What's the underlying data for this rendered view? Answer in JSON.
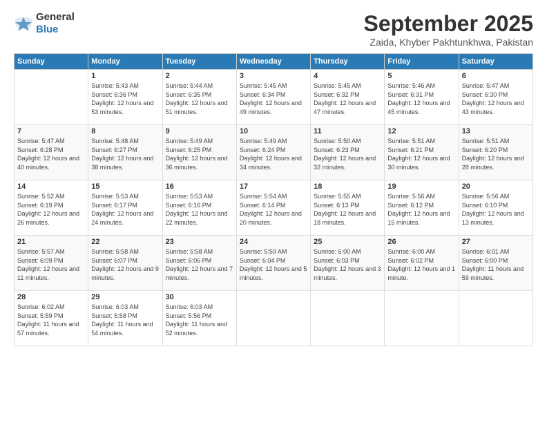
{
  "logo": {
    "general": "General",
    "blue": "Blue"
  },
  "title": "September 2025",
  "location": "Zaida, Khyber Pakhtunkhwa, Pakistan",
  "weekdays": [
    "Sunday",
    "Monday",
    "Tuesday",
    "Wednesday",
    "Thursday",
    "Friday",
    "Saturday"
  ],
  "weeks": [
    [
      {
        "day": null,
        "sunrise": null,
        "sunset": null,
        "daylight": null
      },
      {
        "day": "1",
        "sunrise": "Sunrise: 5:43 AM",
        "sunset": "Sunset: 6:36 PM",
        "daylight": "Daylight: 12 hours and 53 minutes."
      },
      {
        "day": "2",
        "sunrise": "Sunrise: 5:44 AM",
        "sunset": "Sunset: 6:35 PM",
        "daylight": "Daylight: 12 hours and 51 minutes."
      },
      {
        "day": "3",
        "sunrise": "Sunrise: 5:45 AM",
        "sunset": "Sunset: 6:34 PM",
        "daylight": "Daylight: 12 hours and 49 minutes."
      },
      {
        "day": "4",
        "sunrise": "Sunrise: 5:45 AM",
        "sunset": "Sunset: 6:32 PM",
        "daylight": "Daylight: 12 hours and 47 minutes."
      },
      {
        "day": "5",
        "sunrise": "Sunrise: 5:46 AM",
        "sunset": "Sunset: 6:31 PM",
        "daylight": "Daylight: 12 hours and 45 minutes."
      },
      {
        "day": "6",
        "sunrise": "Sunrise: 5:47 AM",
        "sunset": "Sunset: 6:30 PM",
        "daylight": "Daylight: 12 hours and 43 minutes."
      }
    ],
    [
      {
        "day": "7",
        "sunrise": "Sunrise: 5:47 AM",
        "sunset": "Sunset: 6:28 PM",
        "daylight": "Daylight: 12 hours and 40 minutes."
      },
      {
        "day": "8",
        "sunrise": "Sunrise: 5:48 AM",
        "sunset": "Sunset: 6:27 PM",
        "daylight": "Daylight: 12 hours and 38 minutes."
      },
      {
        "day": "9",
        "sunrise": "Sunrise: 5:49 AM",
        "sunset": "Sunset: 6:25 PM",
        "daylight": "Daylight: 12 hours and 36 minutes."
      },
      {
        "day": "10",
        "sunrise": "Sunrise: 5:49 AM",
        "sunset": "Sunset: 6:24 PM",
        "daylight": "Daylight: 12 hours and 34 minutes."
      },
      {
        "day": "11",
        "sunrise": "Sunrise: 5:50 AM",
        "sunset": "Sunset: 6:23 PM",
        "daylight": "Daylight: 12 hours and 32 minutes."
      },
      {
        "day": "12",
        "sunrise": "Sunrise: 5:51 AM",
        "sunset": "Sunset: 6:21 PM",
        "daylight": "Daylight: 12 hours and 30 minutes."
      },
      {
        "day": "13",
        "sunrise": "Sunrise: 5:51 AM",
        "sunset": "Sunset: 6:20 PM",
        "daylight": "Daylight: 12 hours and 28 minutes."
      }
    ],
    [
      {
        "day": "14",
        "sunrise": "Sunrise: 5:52 AM",
        "sunset": "Sunset: 6:19 PM",
        "daylight": "Daylight: 12 hours and 26 minutes."
      },
      {
        "day": "15",
        "sunrise": "Sunrise: 5:53 AM",
        "sunset": "Sunset: 6:17 PM",
        "daylight": "Daylight: 12 hours and 24 minutes."
      },
      {
        "day": "16",
        "sunrise": "Sunrise: 5:53 AM",
        "sunset": "Sunset: 6:16 PM",
        "daylight": "Daylight: 12 hours and 22 minutes."
      },
      {
        "day": "17",
        "sunrise": "Sunrise: 5:54 AM",
        "sunset": "Sunset: 6:14 PM",
        "daylight": "Daylight: 12 hours and 20 minutes."
      },
      {
        "day": "18",
        "sunrise": "Sunrise: 5:55 AM",
        "sunset": "Sunset: 6:13 PM",
        "daylight": "Daylight: 12 hours and 18 minutes."
      },
      {
        "day": "19",
        "sunrise": "Sunrise: 5:56 AM",
        "sunset": "Sunset: 6:12 PM",
        "daylight": "Daylight: 12 hours and 15 minutes."
      },
      {
        "day": "20",
        "sunrise": "Sunrise: 5:56 AM",
        "sunset": "Sunset: 6:10 PM",
        "daylight": "Daylight: 12 hours and 13 minutes."
      }
    ],
    [
      {
        "day": "21",
        "sunrise": "Sunrise: 5:57 AM",
        "sunset": "Sunset: 6:09 PM",
        "daylight": "Daylight: 12 hours and 11 minutes."
      },
      {
        "day": "22",
        "sunrise": "Sunrise: 5:58 AM",
        "sunset": "Sunset: 6:07 PM",
        "daylight": "Daylight: 12 hours and 9 minutes."
      },
      {
        "day": "23",
        "sunrise": "Sunrise: 5:58 AM",
        "sunset": "Sunset: 6:06 PM",
        "daylight": "Daylight: 12 hours and 7 minutes."
      },
      {
        "day": "24",
        "sunrise": "Sunrise: 5:59 AM",
        "sunset": "Sunset: 6:04 PM",
        "daylight": "Daylight: 12 hours and 5 minutes."
      },
      {
        "day": "25",
        "sunrise": "Sunrise: 6:00 AM",
        "sunset": "Sunset: 6:03 PM",
        "daylight": "Daylight: 12 hours and 3 minutes."
      },
      {
        "day": "26",
        "sunrise": "Sunrise: 6:00 AM",
        "sunset": "Sunset: 6:02 PM",
        "daylight": "Daylight: 12 hours and 1 minute."
      },
      {
        "day": "27",
        "sunrise": "Sunrise: 6:01 AM",
        "sunset": "Sunset: 6:00 PM",
        "daylight": "Daylight: 11 hours and 59 minutes."
      }
    ],
    [
      {
        "day": "28",
        "sunrise": "Sunrise: 6:02 AM",
        "sunset": "Sunset: 5:59 PM",
        "daylight": "Daylight: 11 hours and 57 minutes."
      },
      {
        "day": "29",
        "sunrise": "Sunrise: 6:03 AM",
        "sunset": "Sunset: 5:58 PM",
        "daylight": "Daylight: 11 hours and 54 minutes."
      },
      {
        "day": "30",
        "sunrise": "Sunrise: 6:03 AM",
        "sunset": "Sunset: 5:56 PM",
        "daylight": "Daylight: 11 hours and 52 minutes."
      },
      {
        "day": null,
        "sunrise": null,
        "sunset": null,
        "daylight": null
      },
      {
        "day": null,
        "sunrise": null,
        "sunset": null,
        "daylight": null
      },
      {
        "day": null,
        "sunrise": null,
        "sunset": null,
        "daylight": null
      },
      {
        "day": null,
        "sunrise": null,
        "sunset": null,
        "daylight": null
      }
    ]
  ]
}
